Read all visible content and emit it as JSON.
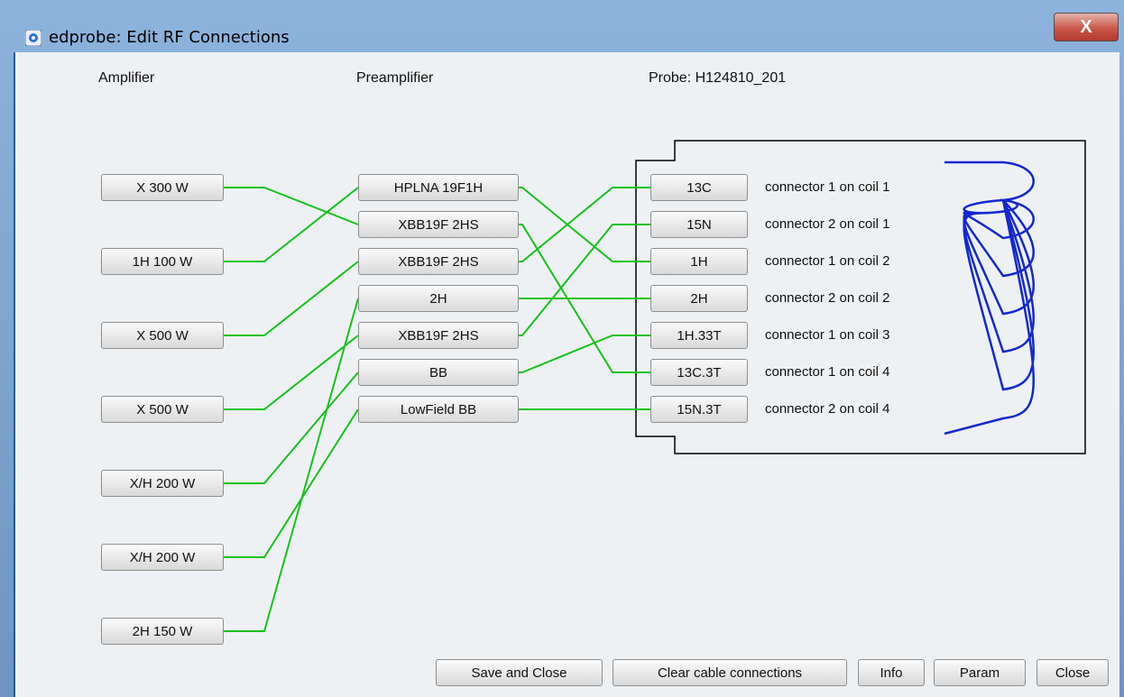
{
  "window": {
    "title": "edprobe: Edit RF Connections",
    "close_glyph": "X"
  },
  "headers": {
    "amplifier": "Amplifier",
    "preamplifier": "Preamplifier",
    "probe": "Probe:  H124810_201"
  },
  "amplifiers": [
    "X 300 W",
    "1H 100 W",
    "X 500 W",
    "X 500 W",
    "X/H 200 W",
    "X/H 200 W",
    "2H 150 W"
  ],
  "preamplifiers": [
    "HPLNA 19F1H",
    "XBB19F 2HS",
    "XBB19F 2HS",
    "2H",
    "XBB19F 2HS",
    "BB",
    "LowField BB"
  ],
  "connectors": [
    {
      "name": "13C",
      "label": "connector 1 on coil 1"
    },
    {
      "name": "15N",
      "label": "connector 2 on coil 1"
    },
    {
      "name": "1H",
      "label": "connector 1 on coil 2"
    },
    {
      "name": "2H",
      "label": "connector 2 on coil 2"
    },
    {
      "name": "1H.33T",
      "label": "connector 1 on coil 3"
    },
    {
      "name": "13C.3T",
      "label": "connector 1 on coil 4"
    },
    {
      "name": "15N.3T",
      "label": "connector 2 on coil 4"
    }
  ],
  "amp_to_preamp": [
    [
      0,
      1
    ],
    [
      1,
      0
    ],
    [
      2,
      2
    ],
    [
      3,
      4
    ],
    [
      4,
      5
    ],
    [
      5,
      6
    ],
    [
      6,
      3
    ]
  ],
  "preamp_to_probe": [
    [
      0,
      2
    ],
    [
      1,
      5
    ],
    [
      2,
      0
    ],
    [
      3,
      3
    ],
    [
      4,
      1
    ],
    [
      5,
      4
    ],
    [
      6,
      6
    ]
  ],
  "colors": {
    "wire": "#16c21b",
    "coil": "#1428d0"
  },
  "buttons": {
    "save": "Save and Close",
    "clear": "Clear cable connections",
    "info": "Info",
    "param": "Param",
    "close": "Close"
  }
}
